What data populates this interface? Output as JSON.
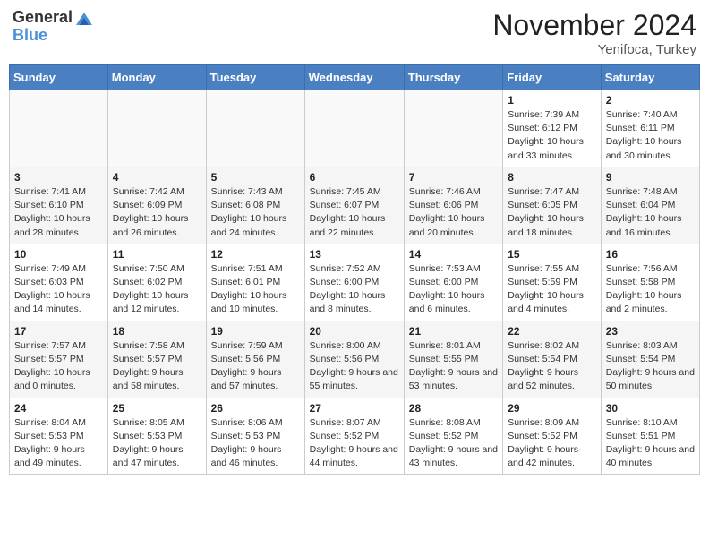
{
  "header": {
    "logo_general": "General",
    "logo_blue": "Blue",
    "month": "November 2024",
    "location": "Yenifoca, Turkey"
  },
  "columns": [
    "Sunday",
    "Monday",
    "Tuesday",
    "Wednesday",
    "Thursday",
    "Friday",
    "Saturday"
  ],
  "weeks": [
    [
      {
        "day": "",
        "info": ""
      },
      {
        "day": "",
        "info": ""
      },
      {
        "day": "",
        "info": ""
      },
      {
        "day": "",
        "info": ""
      },
      {
        "day": "",
        "info": ""
      },
      {
        "day": "1",
        "info": "Sunrise: 7:39 AM\nSunset: 6:12 PM\nDaylight: 10 hours and 33 minutes."
      },
      {
        "day": "2",
        "info": "Sunrise: 7:40 AM\nSunset: 6:11 PM\nDaylight: 10 hours and 30 minutes."
      }
    ],
    [
      {
        "day": "3",
        "info": "Sunrise: 7:41 AM\nSunset: 6:10 PM\nDaylight: 10 hours and 28 minutes."
      },
      {
        "day": "4",
        "info": "Sunrise: 7:42 AM\nSunset: 6:09 PM\nDaylight: 10 hours and 26 minutes."
      },
      {
        "day": "5",
        "info": "Sunrise: 7:43 AM\nSunset: 6:08 PM\nDaylight: 10 hours and 24 minutes."
      },
      {
        "day": "6",
        "info": "Sunrise: 7:45 AM\nSunset: 6:07 PM\nDaylight: 10 hours and 22 minutes."
      },
      {
        "day": "7",
        "info": "Sunrise: 7:46 AM\nSunset: 6:06 PM\nDaylight: 10 hours and 20 minutes."
      },
      {
        "day": "8",
        "info": "Sunrise: 7:47 AM\nSunset: 6:05 PM\nDaylight: 10 hours and 18 minutes."
      },
      {
        "day": "9",
        "info": "Sunrise: 7:48 AM\nSunset: 6:04 PM\nDaylight: 10 hours and 16 minutes."
      }
    ],
    [
      {
        "day": "10",
        "info": "Sunrise: 7:49 AM\nSunset: 6:03 PM\nDaylight: 10 hours and 14 minutes."
      },
      {
        "day": "11",
        "info": "Sunrise: 7:50 AM\nSunset: 6:02 PM\nDaylight: 10 hours and 12 minutes."
      },
      {
        "day": "12",
        "info": "Sunrise: 7:51 AM\nSunset: 6:01 PM\nDaylight: 10 hours and 10 minutes."
      },
      {
        "day": "13",
        "info": "Sunrise: 7:52 AM\nSunset: 6:00 PM\nDaylight: 10 hours and 8 minutes."
      },
      {
        "day": "14",
        "info": "Sunrise: 7:53 AM\nSunset: 6:00 PM\nDaylight: 10 hours and 6 minutes."
      },
      {
        "day": "15",
        "info": "Sunrise: 7:55 AM\nSunset: 5:59 PM\nDaylight: 10 hours and 4 minutes."
      },
      {
        "day": "16",
        "info": "Sunrise: 7:56 AM\nSunset: 5:58 PM\nDaylight: 10 hours and 2 minutes."
      }
    ],
    [
      {
        "day": "17",
        "info": "Sunrise: 7:57 AM\nSunset: 5:57 PM\nDaylight: 10 hours and 0 minutes."
      },
      {
        "day": "18",
        "info": "Sunrise: 7:58 AM\nSunset: 5:57 PM\nDaylight: 9 hours and 58 minutes."
      },
      {
        "day": "19",
        "info": "Sunrise: 7:59 AM\nSunset: 5:56 PM\nDaylight: 9 hours and 57 minutes."
      },
      {
        "day": "20",
        "info": "Sunrise: 8:00 AM\nSunset: 5:56 PM\nDaylight: 9 hours and 55 minutes."
      },
      {
        "day": "21",
        "info": "Sunrise: 8:01 AM\nSunset: 5:55 PM\nDaylight: 9 hours and 53 minutes."
      },
      {
        "day": "22",
        "info": "Sunrise: 8:02 AM\nSunset: 5:54 PM\nDaylight: 9 hours and 52 minutes."
      },
      {
        "day": "23",
        "info": "Sunrise: 8:03 AM\nSunset: 5:54 PM\nDaylight: 9 hours and 50 minutes."
      }
    ],
    [
      {
        "day": "24",
        "info": "Sunrise: 8:04 AM\nSunset: 5:53 PM\nDaylight: 9 hours and 49 minutes."
      },
      {
        "day": "25",
        "info": "Sunrise: 8:05 AM\nSunset: 5:53 PM\nDaylight: 9 hours and 47 minutes."
      },
      {
        "day": "26",
        "info": "Sunrise: 8:06 AM\nSunset: 5:53 PM\nDaylight: 9 hours and 46 minutes."
      },
      {
        "day": "27",
        "info": "Sunrise: 8:07 AM\nSunset: 5:52 PM\nDaylight: 9 hours and 44 minutes."
      },
      {
        "day": "28",
        "info": "Sunrise: 8:08 AM\nSunset: 5:52 PM\nDaylight: 9 hours and 43 minutes."
      },
      {
        "day": "29",
        "info": "Sunrise: 8:09 AM\nSunset: 5:52 PM\nDaylight: 9 hours and 42 minutes."
      },
      {
        "day": "30",
        "info": "Sunrise: 8:10 AM\nSunset: 5:51 PM\nDaylight: 9 hours and 40 minutes."
      }
    ]
  ]
}
